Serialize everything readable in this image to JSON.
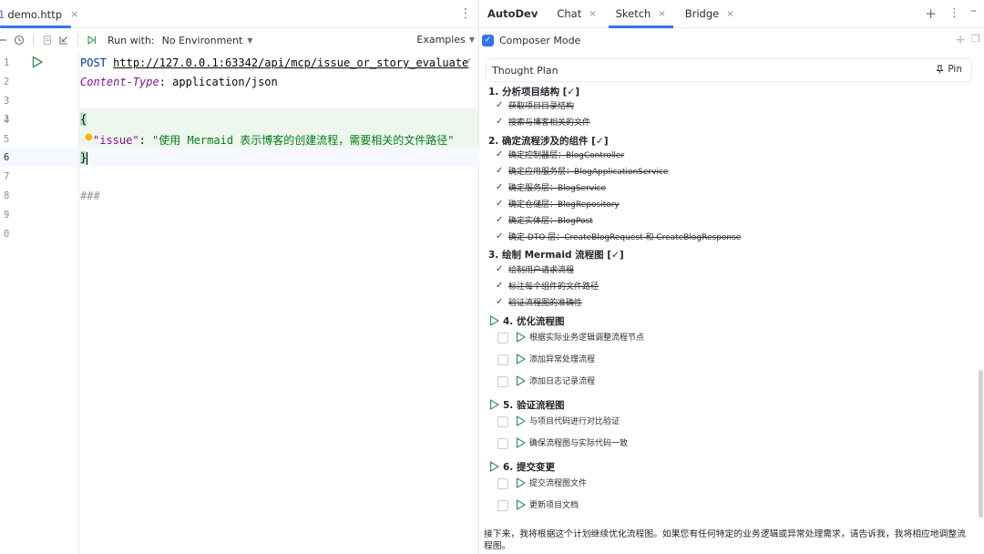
{
  "editor": {
    "file_tab": {
      "icon": "http-file-icon",
      "icon_glyph": "1",
      "label": "demo.http",
      "close": "×"
    },
    "tab_more": "⋮",
    "toolbar": {
      "run_with_label": "Run with:",
      "environment": "No Environment",
      "examples_label": "Examples"
    },
    "line_numbers": [
      "1",
      "2",
      "3",
      "4",
      "5",
      "6",
      "7",
      "8",
      "9",
      "0"
    ],
    "code": {
      "method": "POST",
      "url": "http://127.0.0.1:63342/api/mcp/issue_or_story_evaluate",
      "header_key": "Content-Type",
      "header_sep": ": ",
      "header_value": "application/json",
      "open_brace": "{",
      "json_key": "\"issue\"",
      "json_sep": ": ",
      "json_value": "\"使用 Mermaid 表示博客的创建流程，需要相关的文件路径\"",
      "close_brace": "}",
      "separator": "###"
    }
  },
  "autodev": {
    "title": "AutoDev",
    "tabs": [
      {
        "label": "Chat",
        "close": "×"
      },
      {
        "label": "Sketch",
        "close": "×",
        "active": true
      },
      {
        "label": "Bridge",
        "close": "×"
      }
    ],
    "composer_mode": {
      "label": "Composer Mode",
      "checked": true
    },
    "plan_title": "Thought Plan",
    "pin_label": "Pin",
    "sections": [
      {
        "title": "1. 分析项目结构 [✓]",
        "done": [
          "获取项目目录结构",
          "搜索与博客相关的文件"
        ]
      },
      {
        "title": "2. 确定流程涉及的组件 [✓]",
        "done": [
          "确定控制器层：BlogController",
          "确定应用服务层：BlogApplicationService",
          "确定服务层：BlogService",
          "确定仓储层：BlogRepository",
          "确定实体层：BlogPost",
          "确定 DTO 层：CreateBlogRequest 和 CreateBlogResponse"
        ]
      },
      {
        "title": "3. 绘制 Mermaid 流程图 [✓]",
        "done": [
          "绘制用户请求流程",
          "标注每个组件的文件路径",
          "验证流程图的准确性"
        ]
      },
      {
        "title": "4. 优化流程图",
        "todo": [
          "根据实际业务逻辑调整流程节点",
          "添加异常处理流程",
          "添加日志记录流程"
        ]
      },
      {
        "title": "5. 验证流程图",
        "todo": [
          "与项目代码进行对比验证",
          "确保流程图与实际代码一致"
        ]
      },
      {
        "title": "6. 提交变更",
        "todo": [
          "提交流程图文件",
          "更新项目文档"
        ]
      }
    ],
    "footer_text": "接下来，我将根据这个计划继续优化流程图。如果您有任何特定的业务逻辑或异常处理需求，请告诉我，我将相应地调整流程图。"
  },
  "colors": {
    "accent": "#3574f0",
    "run_green": "#3d8f58",
    "json_string": "#067d17",
    "keyword": "#0033b3",
    "key_purple": "#871094"
  }
}
